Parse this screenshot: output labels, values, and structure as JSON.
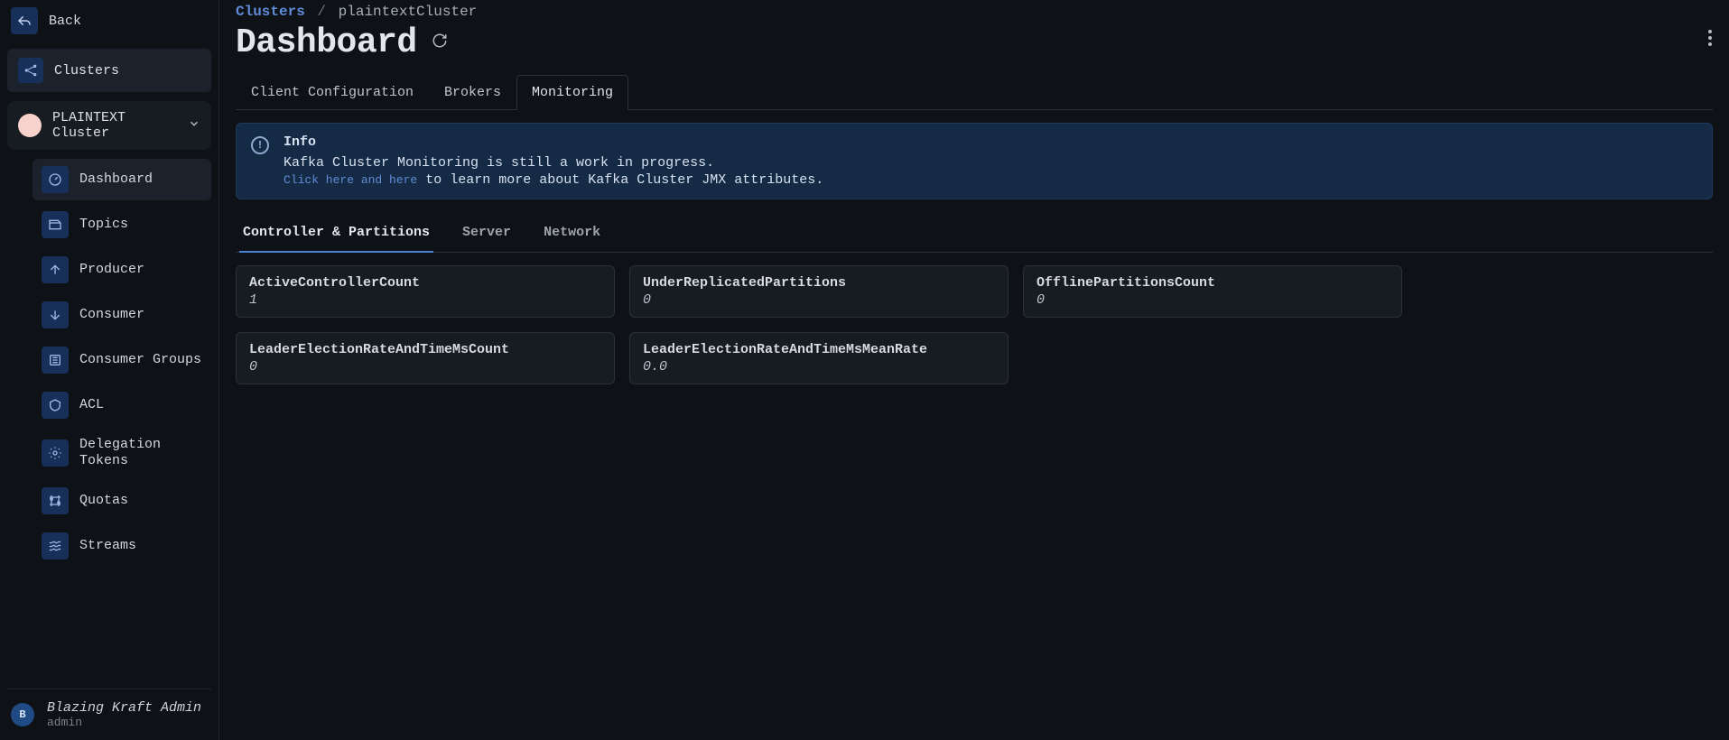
{
  "sidebar": {
    "back_label": "Back",
    "nav": {
      "clusters": {
        "label": "Clusters"
      }
    },
    "cluster_select": {
      "label": "PLAINTEXT Cluster"
    },
    "subnav": [
      {
        "label": "Dashboard"
      },
      {
        "label": "Topics"
      },
      {
        "label": "Producer"
      },
      {
        "label": "Consumer"
      },
      {
        "label": "Consumer Groups"
      },
      {
        "label": "ACL"
      },
      {
        "label": "Delegation Tokens"
      },
      {
        "label": "Quotas"
      },
      {
        "label": "Streams"
      }
    ],
    "footer": {
      "avatar_letter": "B",
      "user": "Blazing Kraft Admin",
      "role": "admin"
    }
  },
  "breadcrumb": {
    "root": "Clusters",
    "sep": "/",
    "leaf": "plaintextCluster"
  },
  "title": "Dashboard",
  "tabs": [
    {
      "label": "Client Configuration"
    },
    {
      "label": "Brokers"
    },
    {
      "label": "Monitoring"
    }
  ],
  "info": {
    "title": "Info",
    "line1": "Kafka Cluster Monitoring is still a work in progress.",
    "link_text": "Click here and here",
    "line2_rest": " to learn more about Kafka Cluster JMX attributes."
  },
  "subtabs": [
    {
      "label": "Controller & Partitions"
    },
    {
      "label": "Server"
    },
    {
      "label": "Network"
    }
  ],
  "metrics": [
    {
      "label": "ActiveControllerCount",
      "value": "1"
    },
    {
      "label": "UnderReplicatedPartitions",
      "value": "0"
    },
    {
      "label": "OfflinePartitionsCount",
      "value": "0"
    },
    {
      "label": "LeaderElectionRateAndTimeMsCount",
      "value": "0"
    },
    {
      "label": "LeaderElectionRateAndTimeMsMeanRate",
      "value": "0.0"
    }
  ]
}
